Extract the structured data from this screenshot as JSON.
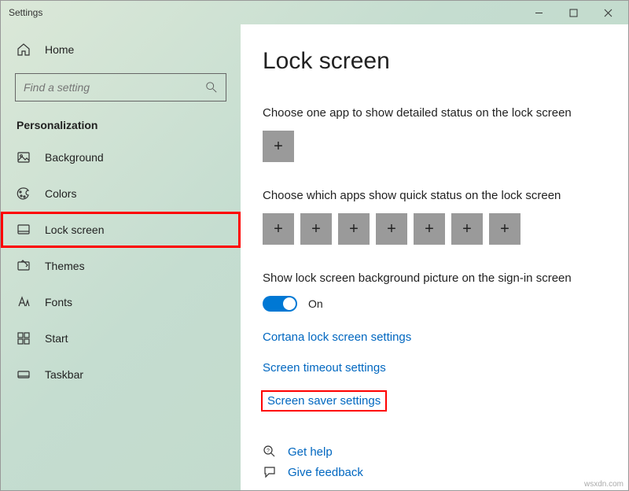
{
  "window": {
    "title": "Settings"
  },
  "sidebar": {
    "home": "Home",
    "search_placeholder": "Find a setting",
    "section": "Personalization",
    "items": [
      {
        "key": "background",
        "label": "Background"
      },
      {
        "key": "colors",
        "label": "Colors"
      },
      {
        "key": "lock-screen",
        "label": "Lock screen",
        "highlighted": true
      },
      {
        "key": "themes",
        "label": "Themes"
      },
      {
        "key": "fonts",
        "label": "Fonts"
      },
      {
        "key": "start",
        "label": "Start"
      },
      {
        "key": "taskbar",
        "label": "Taskbar"
      }
    ]
  },
  "main": {
    "heading": "Lock screen",
    "detailed_status_label": "Choose one app to show detailed status on the lock screen",
    "quick_status_label": "Choose which apps show quick status on the lock screen",
    "quick_status_count": 7,
    "signin_picture_label": "Show lock screen background picture on the sign-in screen",
    "signin_picture_toggle": "On",
    "links": {
      "cortana": "Cortana lock screen settings",
      "timeout": "Screen timeout settings",
      "screensaver": "Screen saver settings"
    },
    "help": "Get help",
    "feedback": "Give feedback"
  },
  "watermark": "wsxdn.com"
}
